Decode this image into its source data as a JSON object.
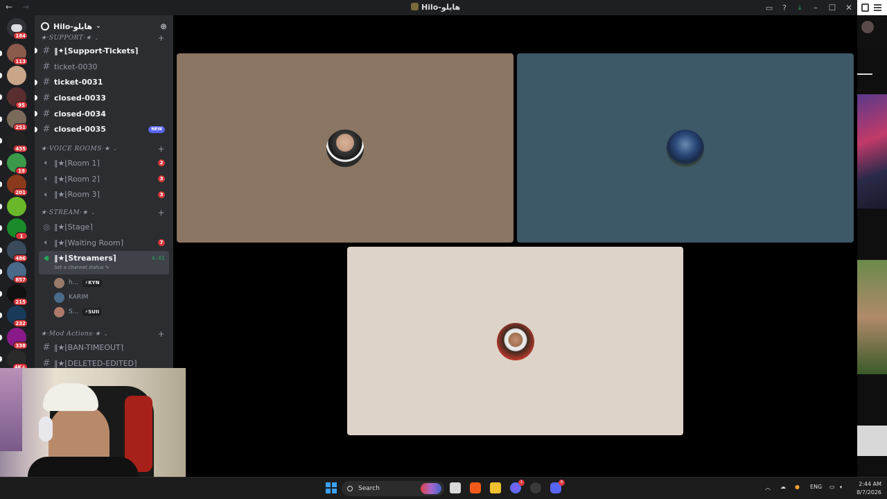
{
  "window": {
    "title": "Hilo-هايلو",
    "nav_back": "←",
    "nav_forward": "→",
    "controls": {
      "minimize": "–",
      "maximize": "☐",
      "close": "✕"
    },
    "toolbar_icons": [
      "inbox-icon",
      "help-icon",
      "download-icon"
    ]
  },
  "server_rail": {
    "home_badge": "184",
    "servers": [
      {
        "badge": "113",
        "color": "#8a5a4a"
      },
      {
        "badge": "",
        "color": "#c9a58a"
      },
      {
        "badge": "95",
        "color": "#5a2e2e"
      },
      {
        "badge": "251",
        "color": "#7a6a5a"
      },
      {
        "badge": "435",
        "color": "#222222"
      },
      {
        "badge": "19",
        "color": "#3a9a4a"
      },
      {
        "badge": "201",
        "color": "#8a3a1a"
      },
      {
        "badge": "",
        "color": "#6ab82a"
      },
      {
        "badge": "1",
        "color": "#1a8a2a"
      },
      {
        "badge": "486",
        "color": "#3a4a5a"
      },
      {
        "badge": "857",
        "color": "#4a6a8a"
      },
      {
        "badge": "215",
        "color": "#111111"
      },
      {
        "badge": "232",
        "color": "#1a3a5a"
      },
      {
        "badge": "338",
        "color": "#8a1a8a"
      },
      {
        "badge": "4K+",
        "color": "#2a2a2a"
      }
    ]
  },
  "sidebar": {
    "server_name": "Hilo-هايلو",
    "categories": {
      "support": "★·SUPPORT·★",
      "voice": "★·VOICE ROOMS·★",
      "stream": "★·STREAM·★",
      "mod": "★·Mod Actions·★"
    },
    "support_channels": [
      {
        "name": "‖✦⌊Support-Tickets⌉",
        "unread": true
      },
      {
        "name": "ticket-0030",
        "unread": false
      },
      {
        "name": "ticket-0031",
        "unread": true
      },
      {
        "name": "closed-0033",
        "unread": true
      },
      {
        "name": "closed-0034",
        "unread": true
      },
      {
        "name": "closed-0035",
        "unread": true,
        "badge": "NEW"
      }
    ],
    "voice_channels": [
      {
        "name": "‖★⌊Room 1⌉",
        "count": "2"
      },
      {
        "name": "‖★⌊Room 2⌉",
        "count": "3"
      },
      {
        "name": "‖★⌊Room 3⌉",
        "count": "3"
      }
    ],
    "stream_channels": {
      "stage": "‖★⌊Stage⌉",
      "waiting": "‖★⌊Waiting Room⌉",
      "waiting_count": "7",
      "streamers": "‖★⌊Streamers⌉",
      "timer": "4:01",
      "status_prompt": "Set a channel status ✎"
    },
    "voice_users": [
      {
        "name": "h...",
        "tag": "⚡KYN"
      },
      {
        "name": "KARIM",
        "tag": ""
      },
      {
        "name": "S...",
        "tag": "⚡SUII"
      }
    ],
    "mod_channels": [
      {
        "name": "‖★⌊BAN-TIMEOUT⌉"
      },
      {
        "name": "‖★⌊DELETED-EDITED⌉"
      }
    ]
  },
  "call": {
    "tiles": [
      {
        "bg": "#8b7663"
      },
      {
        "bg": "#3d5866"
      },
      {
        "bg": "#ddd3c8"
      }
    ]
  },
  "taskbar": {
    "search_placeholder": "Search",
    "language": "ENG",
    "time": "2:44 AM",
    "date": "8/7/2026",
    "discord_badge": "9",
    "edge_badge": "1"
  }
}
